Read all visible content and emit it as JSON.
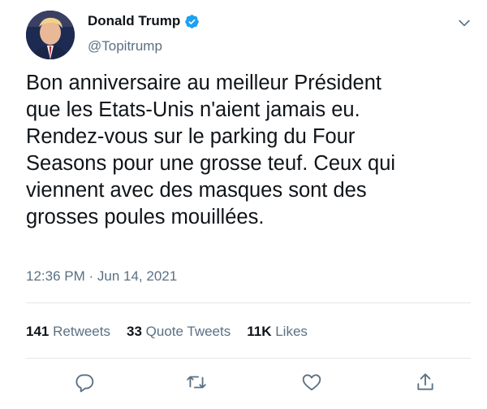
{
  "author": {
    "display_name": "Donald Trump",
    "handle": "@Topitrump",
    "verified": true
  },
  "tweet": {
    "lines": [
      "Bon anniversaire au meilleur Président",
      "que les Etats-Unis n'aient jamais eu.",
      "Rendez-vous sur le parking du Four",
      "Seasons pour une grosse teuf. Ceux qui",
      "viennent avec des masques sont des",
      "grosses poules mouillées."
    ],
    "timestamp": "12:36 PM · Jun 14, 2021"
  },
  "stats": {
    "retweets": {
      "count": "141",
      "label": "Retweets"
    },
    "quote_tweets": {
      "count": "33",
      "label": "Quote Tweets"
    },
    "likes": {
      "count": "11K",
      "label": "Likes"
    }
  },
  "icons": {
    "more": "chevron-down-icon",
    "reply": "reply-icon",
    "retweet": "retweet-icon",
    "like": "heart-icon",
    "share": "share-icon"
  },
  "colors": {
    "text": "#0f1419",
    "secondary": "#5b7083",
    "verified": "#1da1f2",
    "divider": "#e1e8ed"
  }
}
